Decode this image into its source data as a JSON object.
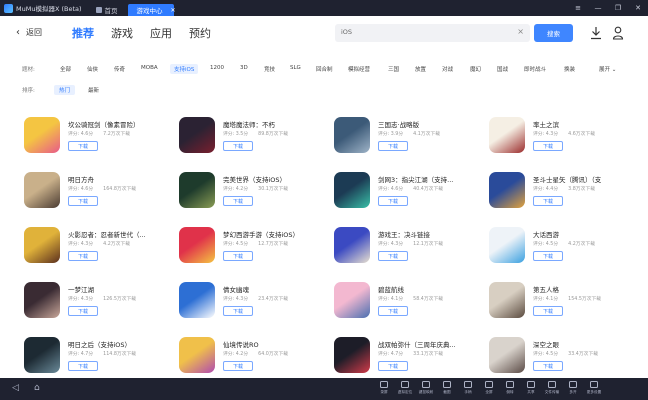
{
  "window": {
    "app_name": "MuMu模拟器X (Beta)",
    "home_tab": "首页",
    "active_tab": "游戏中心",
    "controls": [
      "≡",
      "—",
      "❐",
      "✕"
    ]
  },
  "header": {
    "back_label": "返回",
    "tabs": [
      "推荐",
      "游戏",
      "应用",
      "预约"
    ],
    "active_tab": "推荐",
    "search_value": "iOS",
    "search_button": "搜索",
    "accent_color": "#2f7bff"
  },
  "filters": {
    "category_label": "题材:",
    "categories": [
      "全部",
      "仙侠",
      "传奇",
      "MOBA",
      "支持iOS",
      "1200",
      "3D",
      "竞技",
      "SLG",
      "回合制",
      "模拟经营",
      "三国",
      "放置",
      "对战",
      "魔幻",
      "国战",
      "即时战斗",
      "换装"
    ],
    "selected_category": "支持iOS",
    "expand_label": "展开 ⌄",
    "sort_label": "排序:",
    "sorts": [
      "热门",
      "最新"
    ],
    "selected_sort": "热门"
  },
  "apps": [
    {
      "name": "坎公骑冠剑（像素冒险）",
      "score": "评分: 4.6分",
      "size": "7.2万次下载",
      "button": "下载",
      "icon": "pixel-knight-icon"
    },
    {
      "name": "魔塔魔法师：不朽",
      "score": "评分: 3.5分",
      "size": "89.8万次下载",
      "button": "下载",
      "icon": "dark-knight-icon"
    },
    {
      "name": "三国志·战略版",
      "score": "评分: 3.9分",
      "size": "4.1万次下载",
      "button": "下载",
      "icon": "three-kingdoms-icon"
    },
    {
      "name": "率土之滨",
      "score": "评分: 4.3分",
      "size": "4.6万次下载",
      "button": "下载",
      "icon": "shuaitu-icon"
    },
    {
      "name": "明日方舟",
      "score": "评分: 4.6分",
      "size": "164.8万次下载",
      "button": "下载",
      "icon": "arknights-icon"
    },
    {
      "name": "完美世界（支持iOS）",
      "score": "评分: 4.2分",
      "size": "30.1万次下载",
      "button": "下载",
      "icon": "perfect-world-icon"
    },
    {
      "name": "剑网3：指尖江湖（支持...",
      "score": "评分: 4.6分",
      "size": "40.4万次下载",
      "button": "下载",
      "icon": "jx3-icon"
    },
    {
      "name": "圣斗士星矢（腾讯）（支",
      "score": "评分: 4.4分",
      "size": "3.8万次下载",
      "button": "下载",
      "icon": "saint-seiya-icon"
    },
    {
      "name": "火影忍者：忍者新世代（...",
      "score": "评分: 4.3分",
      "size": "4.2万次下载",
      "button": "下载",
      "icon": "naruto-icon"
    },
    {
      "name": "梦幻西游手游（支持iOS）",
      "score": "评分: 4.5分",
      "size": "12.7万次下载",
      "button": "下载",
      "icon": "menghuan-icon"
    },
    {
      "name": "游戏王：决斗链接",
      "score": "评分: 4.3分",
      "size": "12.1万次下载",
      "button": "下载",
      "icon": "yugioh-icon"
    },
    {
      "name": "大话西游",
      "score": "评分: 4.5分",
      "size": "4.2万次下载",
      "button": "下载",
      "icon": "dahua-icon"
    },
    {
      "name": "一梦江湖",
      "score": "评分: 4.3分",
      "size": "126.5万次下载",
      "button": "下载",
      "icon": "yimeng-icon"
    },
    {
      "name": "倩女幽魂",
      "score": "评分: 4.3分",
      "size": "23.4万次下载",
      "button": "下载",
      "icon": "qiannv-icon"
    },
    {
      "name": "碧蓝航线",
      "score": "评分: 4.1分",
      "size": "58.4万次下载",
      "button": "下载",
      "icon": "azur-lane-icon"
    },
    {
      "name": "第五人格",
      "score": "评分: 4.1分",
      "size": "154.5万次下载",
      "button": "下载",
      "icon": "identity-v-icon"
    },
    {
      "name": "明日之后（支持iOS）",
      "score": "评分: 4.7分",
      "size": "114.8万次下载",
      "button": "下载",
      "icon": "lifeafter-icon"
    },
    {
      "name": "仙境传说RO",
      "score": "评分: 4.2分",
      "size": "64.0万次下载",
      "button": "下载",
      "icon": "ro-icon"
    },
    {
      "name": "战双帕弥什（三周年庆典...",
      "score": "评分: 4.7分",
      "size": "33.1万次下载",
      "button": "下载",
      "icon": "pgr-icon"
    },
    {
      "name": "深空之眼",
      "score": "评分: 4.5分",
      "size": "33.4万次下载",
      "button": "下载",
      "icon": "aether-gazer-icon"
    }
  ],
  "toolbar": {
    "items": [
      "录屏",
      "虚拟定位",
      "键鼠映射",
      "截图",
      "手柄",
      "全屏",
      "倒转",
      "共享",
      "文件传输",
      "多开",
      "更多设置"
    ],
    "nav": [
      "◁",
      "⌂"
    ]
  }
}
